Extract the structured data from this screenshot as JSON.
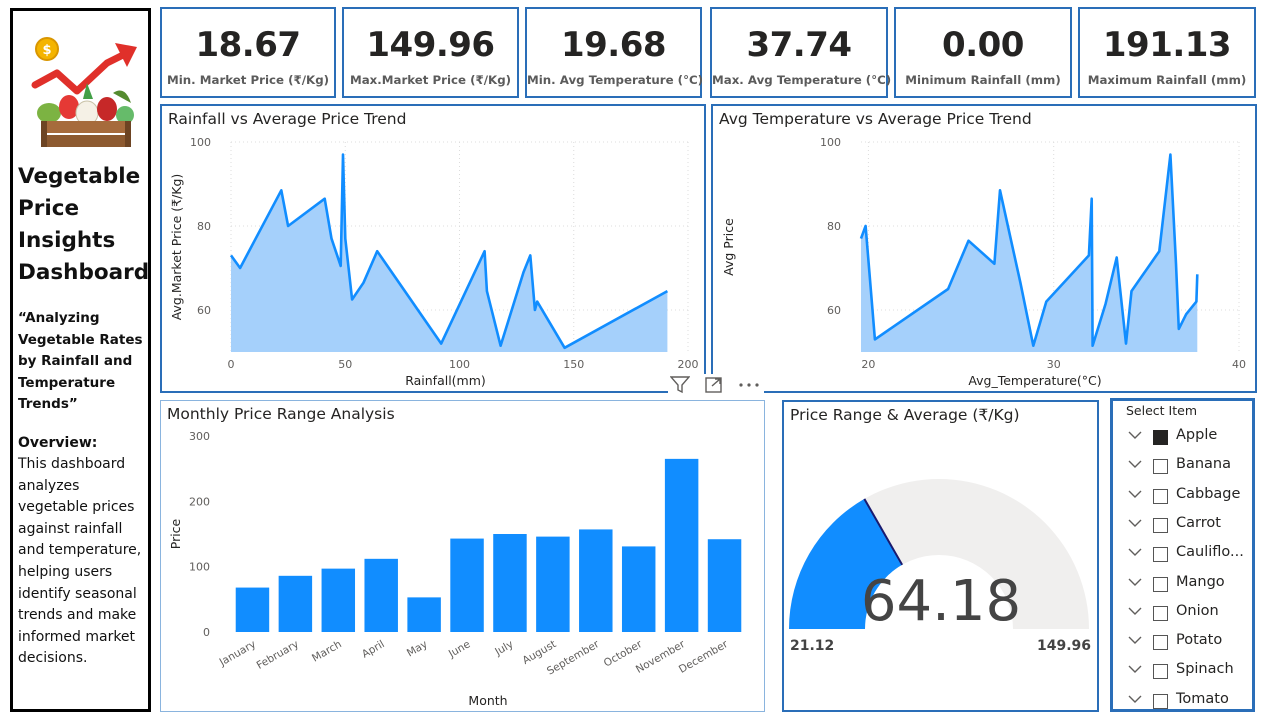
{
  "sidebar": {
    "title": "Vegetable Price Insights Dashboard",
    "title_lines": [
      "Vegetable",
      "Price",
      "Insights",
      "Dashboard"
    ],
    "tagline_lines": [
      "“Analyzing",
      "Vegetable Rates",
      "by Rainfall and",
      "Temperature",
      "Trends”"
    ],
    "overview_heading": "Overview:",
    "overview_lines": [
      "This dashboard",
      "analyzes",
      "vegetable prices",
      "against rainfall",
      "and temperature,",
      "helping users",
      "identify seasonal",
      "trends and make",
      "informed market",
      "decisions."
    ]
  },
  "kpis": [
    {
      "value": "18.67",
      "label": "Min. Market Price (₹/Kg)"
    },
    {
      "value": "149.96",
      "label": "Max.Market Price (₹/Kg)"
    },
    {
      "value": "19.68",
      "label": "Min. Avg Temperature (°C)"
    },
    {
      "value": "37.74",
      "label": "Max. Avg Temperature (°C)"
    },
    {
      "value": "0.00",
      "label": "Minimum Rainfall (mm)"
    },
    {
      "value": "191.13",
      "label": "Maximum Rainfall (mm)"
    }
  ],
  "slicer": {
    "title": "Select Item",
    "items": [
      {
        "label": "Apple",
        "checked": true
      },
      {
        "label": "Banana",
        "checked": false
      },
      {
        "label": "Cabbage",
        "checked": false
      },
      {
        "label": "Carrot",
        "checked": false
      },
      {
        "label": "Cauliflo...",
        "checked": false
      },
      {
        "label": "Mango",
        "checked": false
      },
      {
        "label": "Onion",
        "checked": false
      },
      {
        "label": "Potato",
        "checked": false
      },
      {
        "label": "Spinach",
        "checked": false
      },
      {
        "label": "Tomato",
        "checked": false
      }
    ]
  },
  "visual_header": {
    "filter_icon": "filter-icon",
    "focus_icon": "focus-mode-icon",
    "more_icon": "more-options-icon"
  },
  "colors": {
    "accent": "#118dff",
    "area_fill": "#a5d0fb",
    "card_border": "#2a6eb8",
    "gauge_track": "#f0efee"
  },
  "chart_data": [
    {
      "id": "rainfall",
      "type": "area",
      "title": "Rainfall vs Average Price Trend",
      "xlabel": "Rainfall(mm)",
      "ylabel": "Avg.Market Price (₹/Kg)",
      "xlim": [
        0,
        200
      ],
      "ylim": [
        50,
        100
      ],
      "xticks": [
        0,
        50,
        100,
        150,
        200
      ],
      "yticks": [
        60,
        80,
        100
      ],
      "grid": true,
      "x": [
        0,
        4,
        22,
        25,
        41,
        44,
        48,
        49,
        50,
        53,
        58,
        64,
        92,
        111,
        112,
        118,
        128,
        131,
        133,
        134,
        146,
        191
      ],
      "y": [
        73,
        70,
        88.5,
        80,
        86.5,
        77,
        70.5,
        97,
        77,
        62.5,
        66.5,
        74,
        52,
        74,
        64.5,
        51.5,
        69,
        73,
        60,
        62,
        51,
        64.5
      ]
    },
    {
      "id": "temperature",
      "type": "area",
      "title": "Avg Temperature vs Average Price Trend",
      "xlabel": "Avg_Temperature(°C)",
      "ylabel": "Avg Price",
      "xlim": [
        19.6,
        40
      ],
      "ylim": [
        50,
        100
      ],
      "xticks": [
        20,
        30,
        40
      ],
      "yticks": [
        60,
        80,
        100
      ],
      "grid": true,
      "x": [
        19.6,
        19.85,
        20.35,
        24.3,
        25.4,
        26.8,
        27.1,
        28.2,
        28.9,
        29.6,
        31.9,
        32.05,
        32.1,
        32.8,
        33.4,
        33.9,
        34.2,
        35.7,
        36.3,
        36.6,
        36.75,
        37.15,
        37.7,
        37.75
      ],
      "y": [
        77,
        80,
        53,
        65,
        76.5,
        71,
        88.5,
        66.5,
        51.5,
        62,
        73,
        86.5,
        51.5,
        61.5,
        72.5,
        52,
        64.5,
        74,
        97,
        71,
        55.5,
        59,
        62,
        68.5
      ]
    },
    {
      "id": "monthly",
      "type": "bar",
      "title": "Monthly Price Range Analysis",
      "xlabel": "Month",
      "ylabel": "Price",
      "ylim": [
        0,
        300
      ],
      "yticks": [
        0,
        100,
        200,
        300
      ],
      "grid": false,
      "categories": [
        "January",
        "February",
        "March",
        "April",
        "May",
        "June",
        "July",
        "August",
        "September",
        "October",
        "November",
        "December"
      ],
      "values": [
        68,
        86,
        97,
        112,
        53,
        143,
        150,
        146,
        157,
        131,
        265,
        142
      ]
    },
    {
      "id": "gauge",
      "type": "gauge",
      "title": "Price Range & Average (₹/Kg)",
      "min": 21.12,
      "max": 149.96,
      "value": 64.18,
      "min_label": "21.12",
      "max_label": "149.96",
      "value_label": "64.18"
    }
  ]
}
